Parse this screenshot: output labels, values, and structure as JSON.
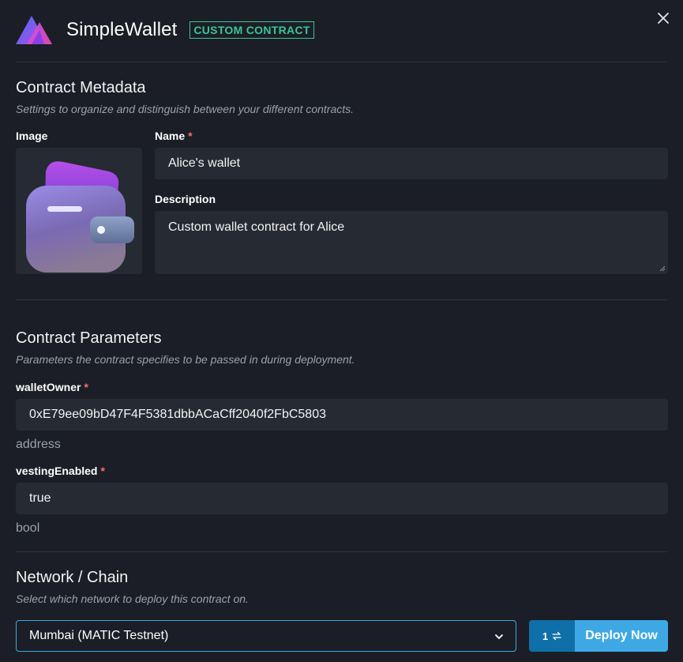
{
  "header": {
    "title": "SimpleWallet",
    "badge": "CUSTOM CONTRACT",
    "logo_icon": "thirdweb-logo-icon",
    "close_icon": "close-icon"
  },
  "metadata": {
    "title": "Contract Metadata",
    "subtitle": "Settings to organize and distinguish between your different contracts.",
    "image_label": "Image",
    "image_icon": "wallet-icon",
    "name_label": "Name",
    "name_value": "Alice's wallet",
    "description_label": "Description",
    "description_value": "Custom wallet contract for Alice"
  },
  "parameters": {
    "title": "Contract Parameters",
    "subtitle": "Parameters the contract specifies to be passed in during deployment.",
    "fields": [
      {
        "label": "walletOwner",
        "value": "0xE79ee09bD47F4F5381dbbACaCff2040f2FbC5803",
        "type": "address"
      },
      {
        "label": "vestingEnabled",
        "value": "true",
        "type": "bool"
      }
    ]
  },
  "required_marker": "*",
  "network": {
    "title": "Network / Chain",
    "subtitle": "Select which network to deploy this contract on.",
    "selected": "Mumbai (MATIC Testnet)",
    "chevron_icon": "chevron-down-icon",
    "batch_count": "1",
    "batch_icon": "swap-arrows-icon",
    "deploy_label": "Deploy Now"
  },
  "colors": {
    "background": "#1b1e26",
    "input_bg": "#262a33",
    "accent_green": "#3ac49a",
    "accent_blue": "#3ea8e5",
    "required_red": "#ff6b6b"
  }
}
